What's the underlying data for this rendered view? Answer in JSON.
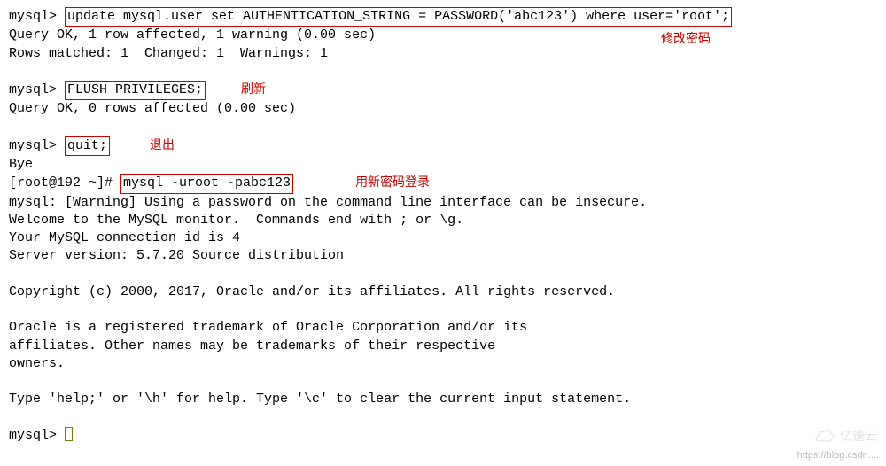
{
  "lines": {
    "l1_prompt": "mysql> ",
    "l1_cmd": "update mysql.user set AUTHENTICATION_STRING = PASSWORD('abc123') where user='root';",
    "l2": "Query OK, 1 row affected, 1 warning (0.00 sec)",
    "l3": "Rows matched: 1  Changed: 1  Warnings: 1",
    "l4_prompt": "mysql> ",
    "l4_cmd": "FLUSH PRIVILEGES;",
    "l5": "Query OK, 0 rows affected (0.00 sec)",
    "l6_prompt": "mysql> ",
    "l6_cmd": "quit;",
    "l7": "Bye",
    "l8_prompt": "[root@192 ~]# ",
    "l8_cmd": "mysql -uroot -pabc123",
    "l9": "mysql: [Warning] Using a password on the command line interface can be insecure.",
    "l10": "Welcome to the MySQL monitor.  Commands end with ; or \\g.",
    "l11": "Your MySQL connection id is 4",
    "l12": "Server version: 5.7.20 Source distribution",
    "l13": "Copyright (c) 2000, 2017, Oracle and/or its affiliates. All rights reserved.",
    "l14": "Oracle is a registered trademark of Oracle Corporation and/or its",
    "l15": "affiliates. Other names may be trademarks of their respective",
    "l16": "owners.",
    "l17": "Type 'help;' or '\\h' for help. Type '\\c' to clear the current input statement.",
    "l18_prompt": "mysql> "
  },
  "annotations": {
    "a1": "修改密码",
    "a2": "刷新",
    "a3": "退出",
    "a4": "用新密码登录"
  },
  "watermark": {
    "url": "https://blog.csdn....",
    "brand": "亿速云"
  }
}
